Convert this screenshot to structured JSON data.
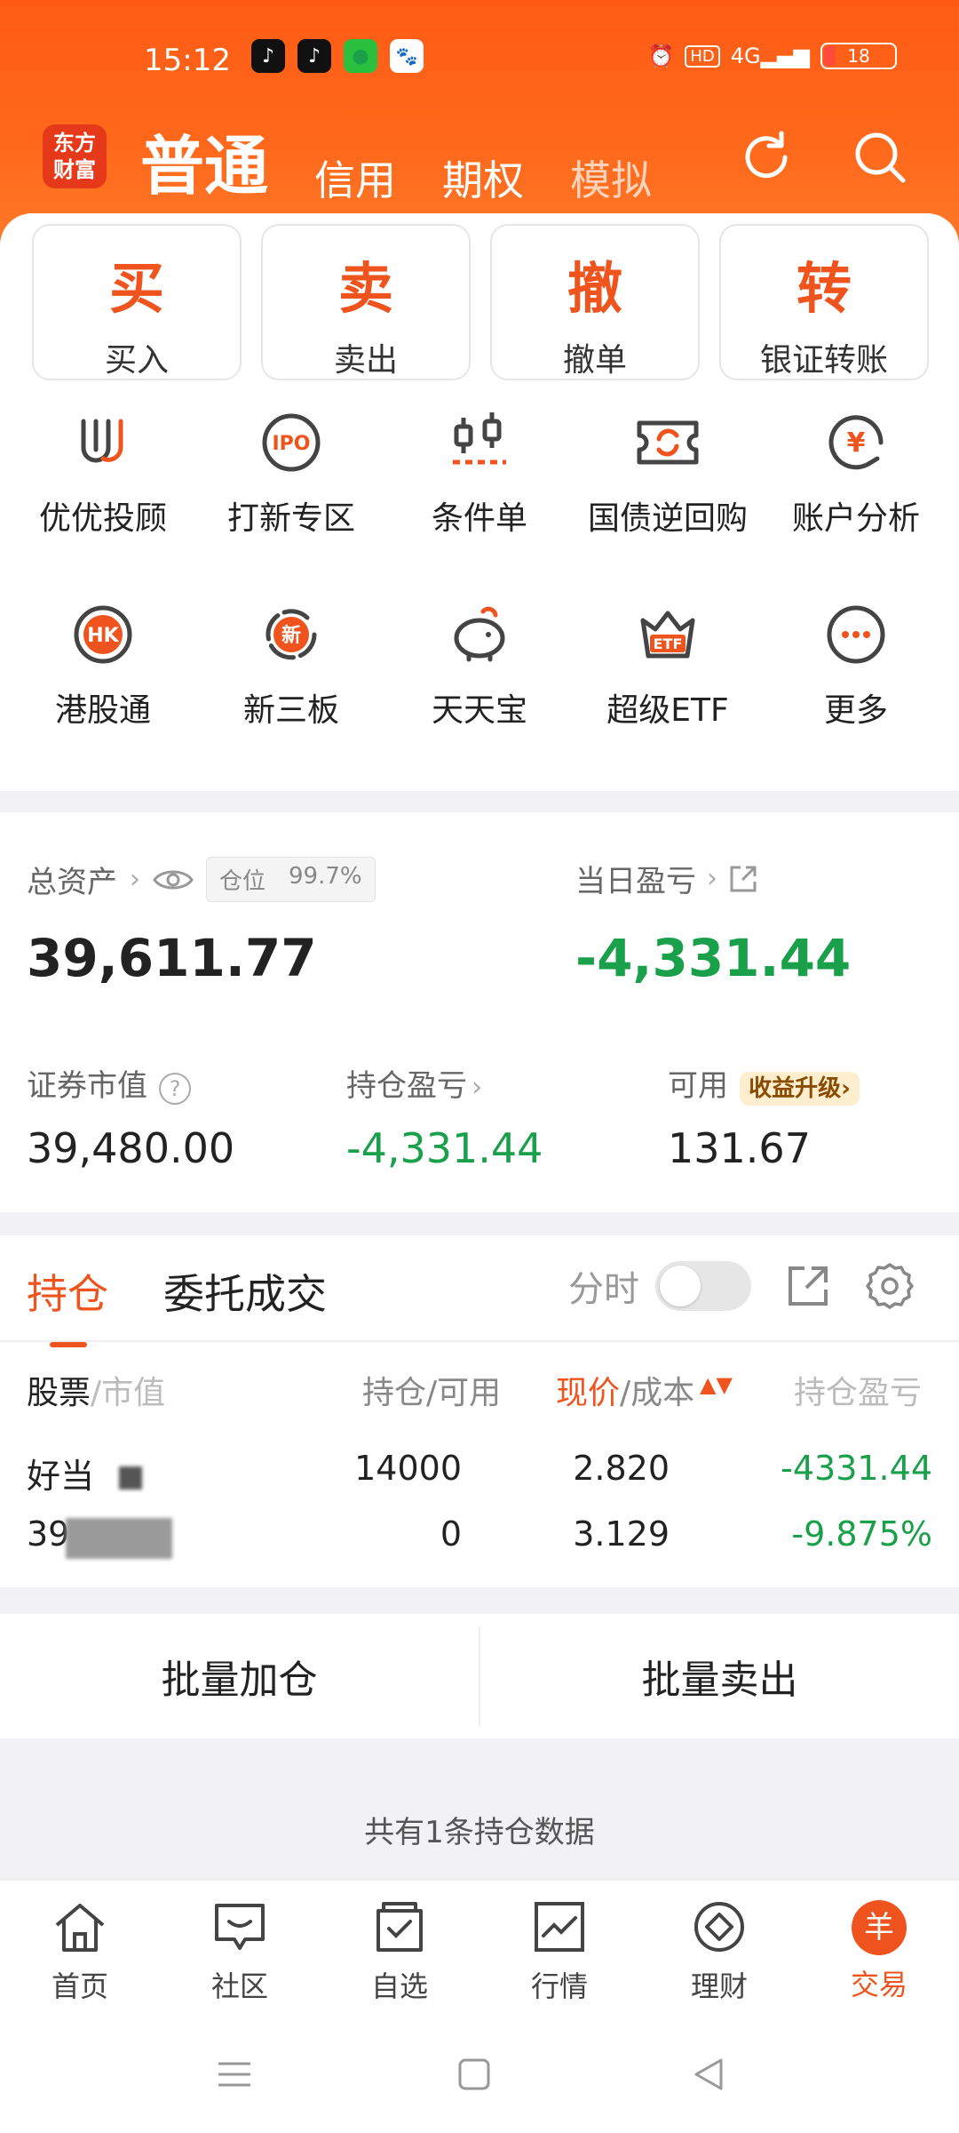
{
  "status": {
    "time": "15:12",
    "battery": "18",
    "hd": "HD",
    "net": "4G"
  },
  "header": {
    "logo": "东方\n财富",
    "tabs": [
      "普通",
      "信用",
      "期权",
      "模拟"
    ]
  },
  "actions": [
    {
      "big": "买",
      "small": "买入"
    },
    {
      "big": "卖",
      "small": "卖出"
    },
    {
      "big": "撤",
      "small": "撤单"
    },
    {
      "big": "转",
      "small": "银证转账"
    }
  ],
  "grid": [
    {
      "label": "优优投顾",
      "icon": "uu-advisor-icon"
    },
    {
      "label": "打新专区",
      "icon": "ipo-icon"
    },
    {
      "label": "条件单",
      "icon": "condition-order-icon"
    },
    {
      "label": "国债逆回购",
      "icon": "bond-repo-icon"
    },
    {
      "label": "账户分析",
      "icon": "account-analysis-icon"
    },
    {
      "label": "港股通",
      "icon": "hk-connect-icon"
    },
    {
      "label": "新三板",
      "icon": "neeq-icon"
    },
    {
      "label": "天天宝",
      "icon": "piggy-bank-icon"
    },
    {
      "label": "超级ETF",
      "icon": "etf-icon"
    },
    {
      "label": "更多",
      "icon": "more-icon"
    }
  ],
  "icon_texts": {
    "ipo": "IPO",
    "hk": "HK",
    "xin": "新",
    "etf": "ETF",
    "yuan": "¥"
  },
  "assets": {
    "total_label": "总资产",
    "position_label": "仓位",
    "position_value": "99.7%",
    "total_value": "39,611.77",
    "day_pnl_label": "当日盈亏",
    "day_pnl_value": "-4,331.44",
    "market_value_label": "证券市值",
    "market_value": "39,480.00",
    "hold_pnl_label": "持仓盈亏",
    "hold_pnl_value": "-4,331.44",
    "available_label": "可用",
    "upgrade_label": "收益升级",
    "available_value": "131.67"
  },
  "holdings": {
    "tabs": [
      "持仓",
      "委托成交"
    ],
    "toggle_label": "分时",
    "headers": {
      "stock": "股票",
      "mv": "/市值",
      "qty": "持仓/可用",
      "price": "现价",
      "cost": "/成本",
      "pnl": "持仓盈亏"
    },
    "row": {
      "name": "好当",
      "mv_prefix": "39",
      "qty": "14000",
      "avail": "0",
      "price": "2.820",
      "cost": "3.129",
      "pnl": "-4331.44",
      "pnl_pct": "-9.875%"
    }
  },
  "batch": {
    "add": "批量加仓",
    "sell": "批量卖出"
  },
  "note": "共有1条持仓数据",
  "bottom_nav": [
    "首页",
    "社区",
    "自选",
    "行情",
    "理财",
    "交易"
  ],
  "bottom_nav_active_icon": "羊",
  "colors": {
    "accent": "#f0541e",
    "header": "#ff5a14",
    "loss": "#1aa04a"
  }
}
